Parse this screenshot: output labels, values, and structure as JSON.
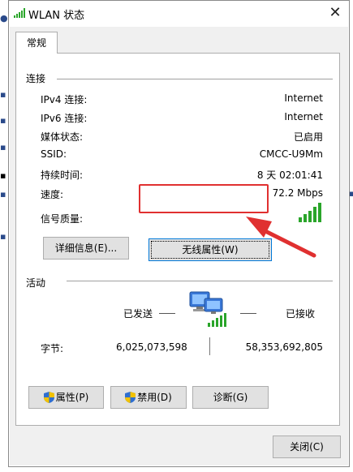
{
  "window": {
    "title": "WLAN 状态"
  },
  "tabs": [
    {
      "label": "常规"
    }
  ],
  "connection": {
    "section_title": "连接",
    "rows": [
      {
        "label": "IPv4 连接:",
        "value": "Internet"
      },
      {
        "label": "IPv6 连接:",
        "value": "Internet"
      },
      {
        "label": "媒体状态:",
        "value": "已启用"
      },
      {
        "label": "SSID:",
        "value": "CMCC-U9Mm"
      },
      {
        "label": "持续时间:",
        "value": "8 天 02:01:41"
      },
      {
        "label": "速度:",
        "value": "72.2 Mbps"
      }
    ],
    "signal_label": "信号质量:",
    "signal_bars": 5,
    "details_button": "详细信息(E)...",
    "wireless_props_button": "无线属性(W)"
  },
  "activity": {
    "section_title": "活动",
    "sent_label": "已发送",
    "received_label": "已接收",
    "bytes_label": "字节:",
    "bytes_sent": "6,025,073,598",
    "bytes_received": "58,353,692,805"
  },
  "buttons": {
    "properties": "属性(P)",
    "disable": "禁用(D)",
    "diagnose": "诊断(G)",
    "close": "关闭(C)"
  },
  "colors": {
    "annotation_red": "#e03030",
    "signal_green": "#2aa52a"
  }
}
